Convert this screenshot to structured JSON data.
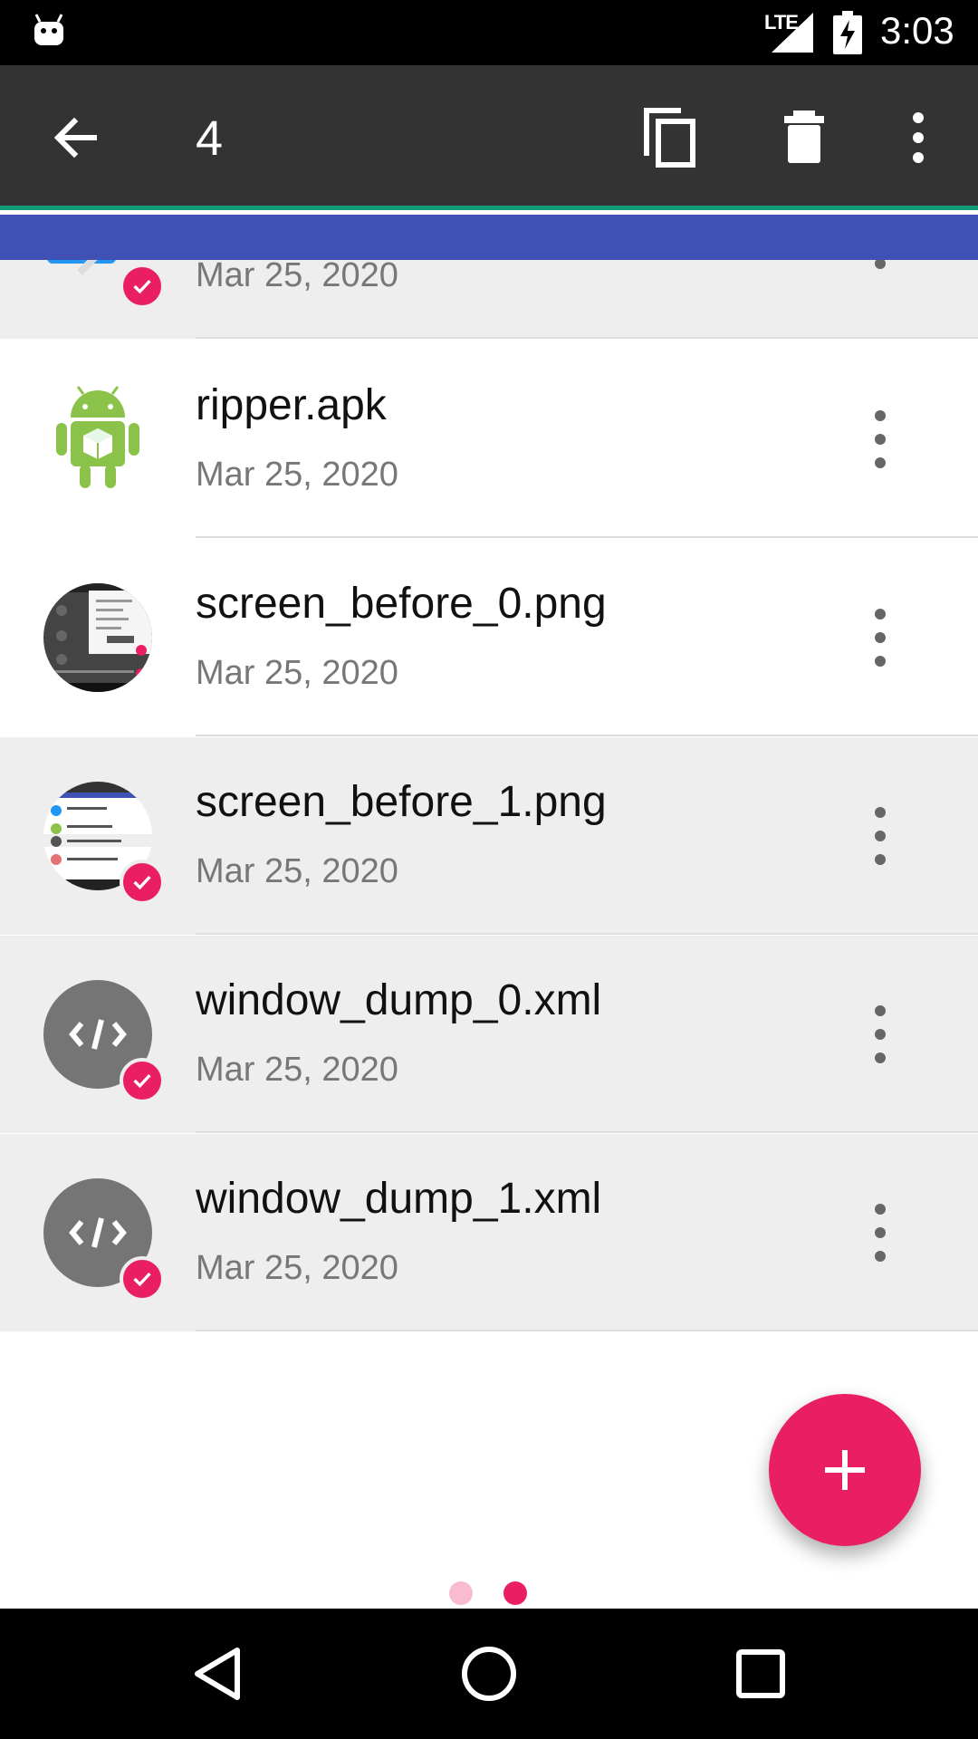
{
  "status_bar": {
    "network": "LTE",
    "time": "3:03",
    "icons": [
      "android-notification-icon",
      "signal-icon",
      "battery-charging-icon"
    ]
  },
  "toolbar": {
    "selected_count": "4",
    "icons": [
      "back-arrow-icon",
      "copy-icon",
      "delete-icon",
      "more-vert-icon"
    ]
  },
  "files": [
    {
      "name": "",
      "date": "Mar 25, 2020",
      "selected": true,
      "icon": "image-thumbnail-icon"
    },
    {
      "name": "ripper.apk",
      "date": "Mar 25, 2020",
      "selected": false,
      "icon": "android-apk-icon"
    },
    {
      "name": "screen_before_0.png",
      "date": "Mar 25, 2020",
      "selected": false,
      "icon": "screenshot-thumbnail-icon"
    },
    {
      "name": "screen_before_1.png",
      "date": "Mar 25, 2020",
      "selected": true,
      "icon": "screenshot-thumbnail-icon"
    },
    {
      "name": "window_dump_0.xml",
      "date": "Mar 25, 2020",
      "selected": true,
      "icon": "code-file-icon"
    },
    {
      "name": "window_dump_1.xml",
      "date": "Mar 25, 2020",
      "selected": true,
      "icon": "code-file-icon"
    }
  ],
  "fab": {
    "icon": "plus-icon"
  },
  "pager": {
    "pages": 2,
    "current": 2
  },
  "nav_bar": {
    "icons": [
      "nav-back-icon",
      "nav-home-icon",
      "nav-recents-icon"
    ]
  },
  "colors": {
    "toolbar": "#333333",
    "tab_strip": "#3f51b5",
    "accent": "#e91e63",
    "selected_row": "#eeeeee",
    "teal_line": "#139b7a"
  }
}
